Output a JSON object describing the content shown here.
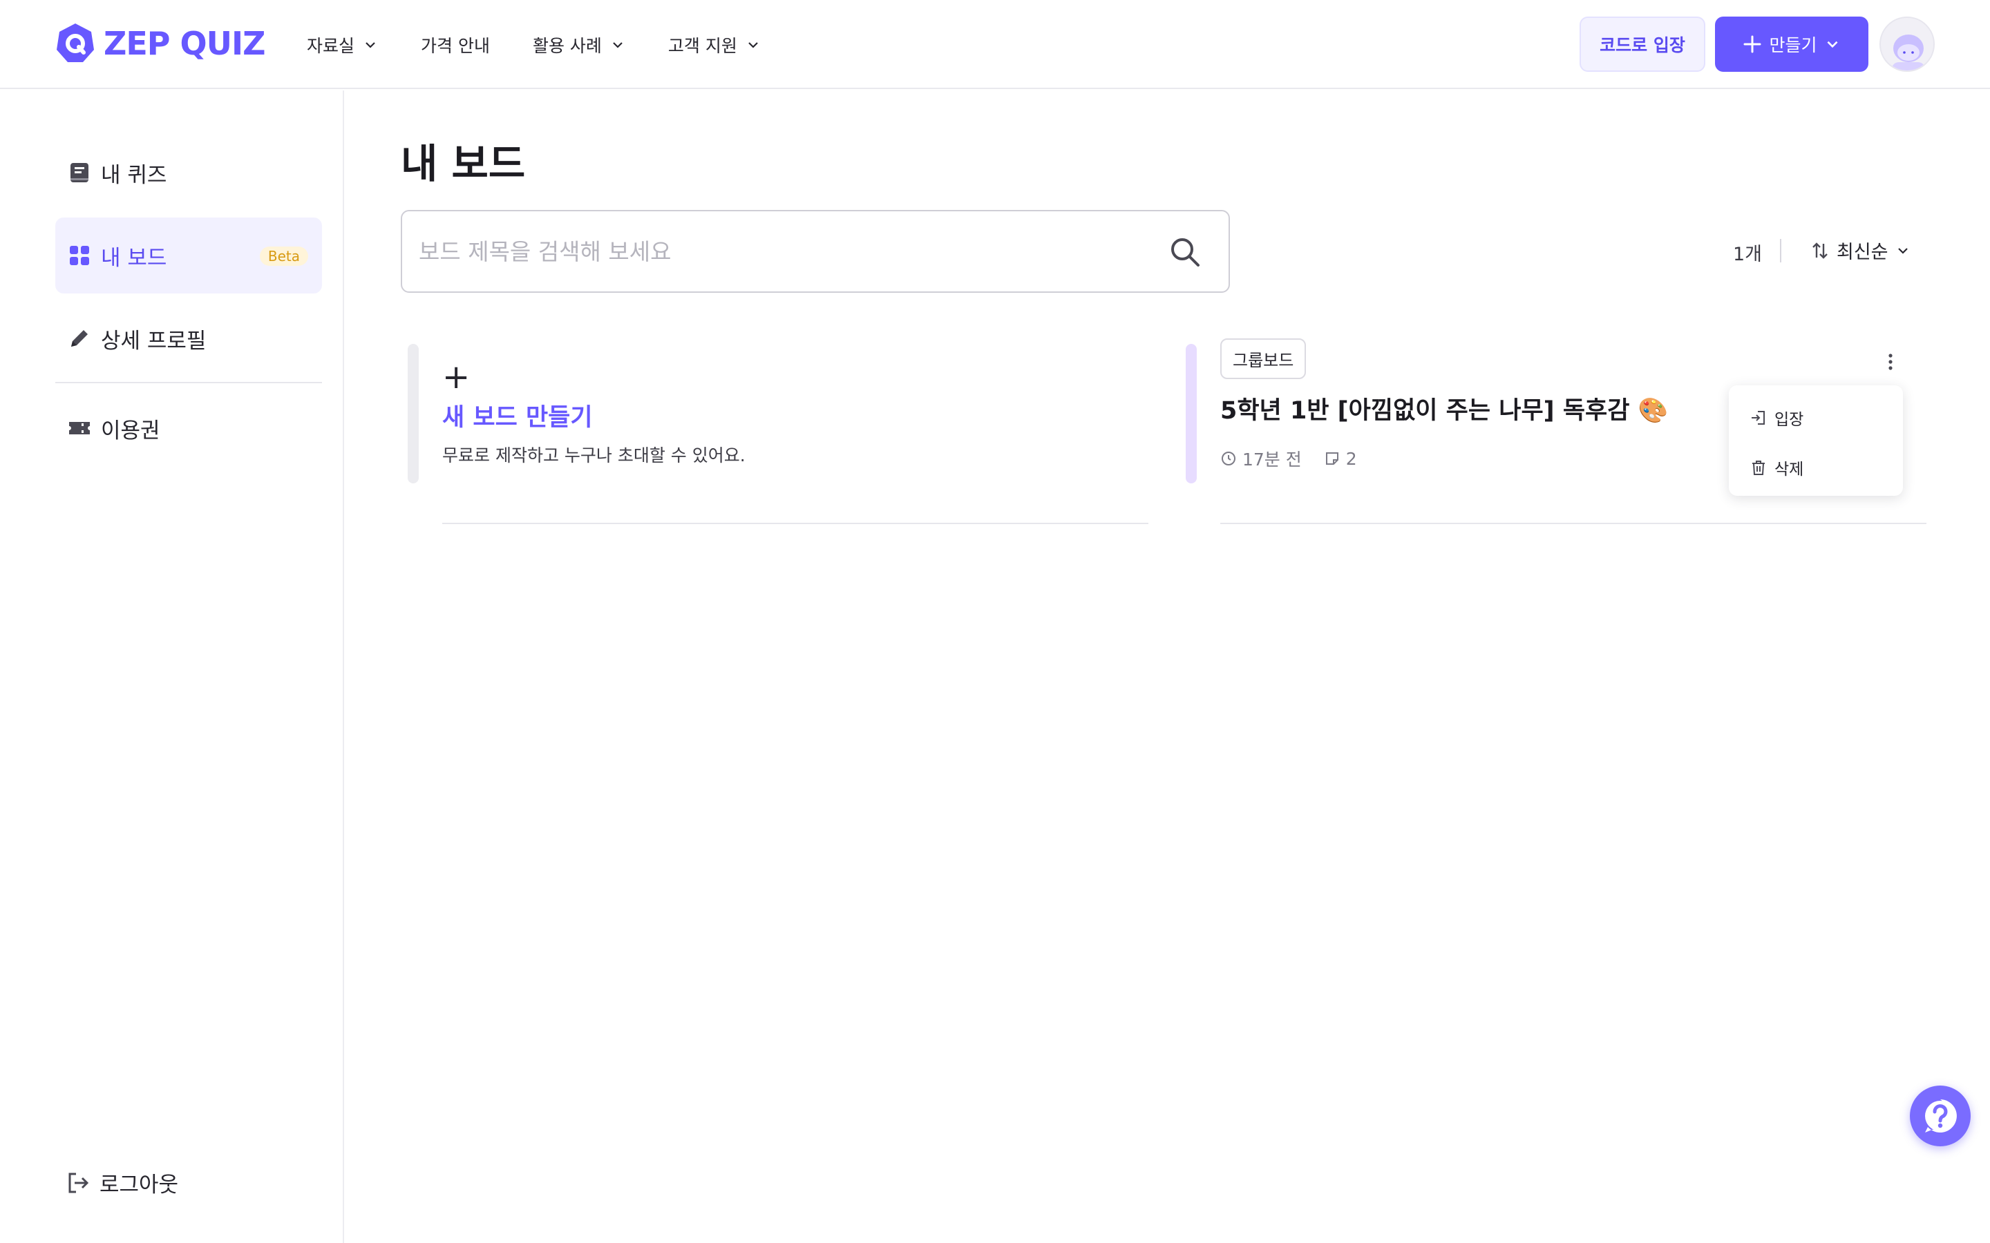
{
  "header": {
    "logo_text": "ZEP QUIZ",
    "nav": [
      {
        "label": "자료실",
        "dropdown": true
      },
      {
        "label": "가격 안내",
        "dropdown": false
      },
      {
        "label": "활용 사례",
        "dropdown": true
      },
      {
        "label": "고객 지원",
        "dropdown": true
      }
    ],
    "code_button": "코드로 입장",
    "make_button": "만들기"
  },
  "sidebar": {
    "items": [
      {
        "label": "내 퀴즈",
        "icon": "book-icon"
      },
      {
        "label": "내 보드",
        "icon": "grid-icon",
        "active": true,
        "badge": "Beta"
      },
      {
        "label": "상세 프로필",
        "icon": "pencil-icon"
      },
      {
        "label": "이용권",
        "icon": "ticket-icon"
      }
    ],
    "logout": "로그아웃"
  },
  "main": {
    "title": "내 보드",
    "search_placeholder": "보드 제목을 검색해 보세요",
    "count": "1개",
    "sort_label": "최신순",
    "new_board": {
      "plus": "+",
      "title": "새 보드 만들기",
      "desc": "무료로 제작하고 누구나 초대할 수 있어요."
    },
    "board": {
      "tag": "그룹보드",
      "title": "5학년 1반 [아낌없이 주는 나무] 독후감 🎨",
      "time": "17분 전",
      "posts": "2"
    },
    "menu": {
      "enter": "입장",
      "delete": "삭제"
    }
  },
  "colors": {
    "accent": "#6758ff",
    "accent_light": "#f2f1ff",
    "board_bar": "#e7dcff"
  }
}
